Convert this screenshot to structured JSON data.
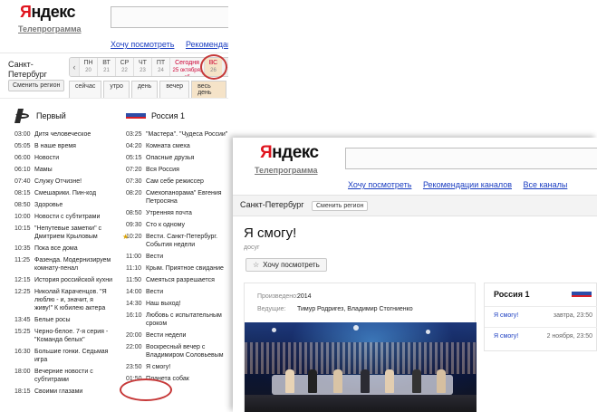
{
  "left": {
    "logo_ya": "Я",
    "logo_rest": "ндекс",
    "subtitle": "Телепрограмма",
    "links": [
      "Хочу посмотреть",
      "Рекомендаци"
    ],
    "city": "Санкт-Петербург",
    "change_city": "Сменить регион",
    "prev_arrow": "‹",
    "next_arrow": "›",
    "days": [
      {
        "label": "ПН",
        "date": "20"
      },
      {
        "label": "ВТ",
        "date": "21"
      },
      {
        "label": "СР",
        "date": "22"
      },
      {
        "label": "ЧТ",
        "date": "23"
      },
      {
        "label": "ПТ",
        "date": "24"
      },
      {
        "label": "Сегодня",
        "date": "25 октября, сб"
      },
      {
        "label": "ВС",
        "date": "26"
      }
    ],
    "filters": [
      "сейчас",
      "утро",
      "день",
      "вечер",
      "весь день"
    ],
    "channel1": {
      "name": "Первый",
      "programs": [
        {
          "time": "03:00",
          "title": "Дитя человеческое"
        },
        {
          "time": "05:05",
          "title": "В наше время"
        },
        {
          "time": "06:00",
          "title": "Новости"
        },
        {
          "time": "06:10",
          "title": "Мамы"
        },
        {
          "time": "07:40",
          "title": "Служу Отчизне!"
        },
        {
          "time": "08:15",
          "title": "Смешарики. Пин-код"
        },
        {
          "time": "08:50",
          "title": "Здоровье"
        },
        {
          "time": "10:00",
          "title": "Новости с субтитрами"
        },
        {
          "time": "10:15",
          "title": "\"Непутевые заметки\" с Дмитрием Крыловым"
        },
        {
          "time": "10:35",
          "title": "Пока все дома"
        },
        {
          "time": "11:25",
          "title": "Фазенда. Модернизируем комнату-пенал"
        },
        {
          "time": "12:15",
          "title": "История российской кухни"
        },
        {
          "time": "12:25",
          "title": "Николай Караченцов. \"Я люблю - и, значит, я живу!\" К юбилею актера"
        },
        {
          "time": "13:45",
          "title": "Белые росы"
        },
        {
          "time": "15:25",
          "title": "Черно-белое. 7-я серия - \"Команда белых\""
        },
        {
          "time": "16:30",
          "title": "Большие гонки. Седьмая игра"
        },
        {
          "time": "18:00",
          "title": "Вечерние новости с субтитрами"
        },
        {
          "time": "18:15",
          "title": "Своими глазами"
        }
      ]
    },
    "channel2": {
      "name": "Россия 1",
      "logo_text": "РОССИЯ 1",
      "star": "★",
      "programs": [
        {
          "time": "03:25",
          "title": "\"Мастера\". \"Чудеса России\""
        },
        {
          "time": "04:20",
          "title": "Комната смеха"
        },
        {
          "time": "05:15",
          "title": "Опасные друзья"
        },
        {
          "time": "07:20",
          "title": "Вся Россия"
        },
        {
          "time": "07:30",
          "title": "Сам себе режиссер"
        },
        {
          "time": "08:20",
          "title": "Смехопанорама\" Евгения Петросяна"
        },
        {
          "time": "08:50",
          "title": "Утренняя почта"
        },
        {
          "time": "09:30",
          "title": "Сто к одному"
        },
        {
          "time": "10:20",
          "title": "Вести. Санкт-Петербург. События недели"
        },
        {
          "time": "11:00",
          "title": "Вести"
        },
        {
          "time": "11:10",
          "title": "Крым. Приятное свидание"
        },
        {
          "time": "11:50",
          "title": "Смеяться разрешается"
        },
        {
          "time": "14:00",
          "title": "Вести"
        },
        {
          "time": "14:30",
          "title": "Наш выход!"
        },
        {
          "time": "16:10",
          "title": "Любовь с испытательным сроком"
        },
        {
          "time": "20:00",
          "title": "Вести недели"
        },
        {
          "time": "22:00",
          "title": "Воскресный вечер с Владимиром Соловьевым"
        },
        {
          "time": "23:50",
          "title": "Я смогу!"
        },
        {
          "time": "01:50",
          "title": "Планета собак"
        }
      ]
    }
  },
  "right": {
    "logo_ya": "Я",
    "logo_rest": "ндекс",
    "subtitle": "Телепрограмма",
    "links": [
      "Хочу посмотреть",
      "Рекомендации каналов",
      "Все каналы"
    ],
    "city": "Санкт-Петербург",
    "change_city": "Сменить регион",
    "title": "Я смогу!",
    "genre": "досуг",
    "want_button": "Хочу посмотреть",
    "want_icon": "☆",
    "produced_label": "Произведено:",
    "produced_value": "2014",
    "hosts_label": "Ведущие:",
    "hosts_value": "Тимур Родригез, Владимир Стогниенко",
    "panel_title": "Россия 1",
    "panel_logo_text": "РОССИЯ 1",
    "airings": [
      {
        "title": "Я смогу!",
        "when": "завтра, 23:50"
      },
      {
        "title": "Я смогу!",
        "when": "2 ноября, 23:50"
      }
    ]
  },
  "colors": {
    "accent_red": "#e0141e",
    "link_blue": "#1a3dc1",
    "highlight_circle": "#c63838",
    "selected_day": "#f5e3c8"
  }
}
